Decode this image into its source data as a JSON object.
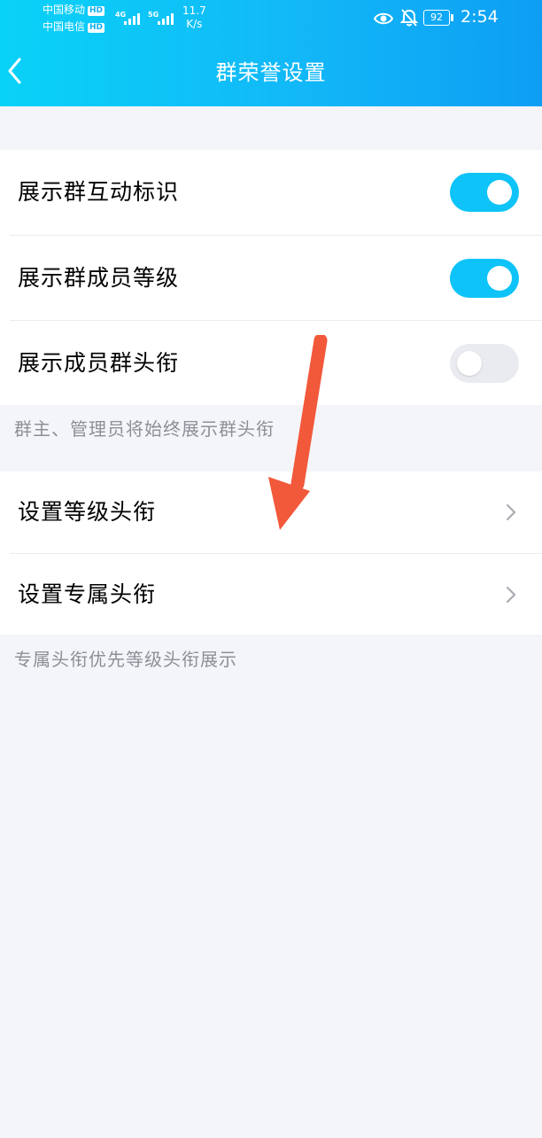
{
  "status_bar": {
    "carrier1": "中国移动",
    "carrier2": "中国电信",
    "hd_badge": "HD",
    "net1": "4G",
    "net2": "5G",
    "speed_value": "11.7",
    "speed_unit": "K/s",
    "battery": "92",
    "time": "2:54"
  },
  "header": {
    "title": "群荣誉设置"
  },
  "toggles": [
    {
      "label": "展示群互动标识",
      "on": true
    },
    {
      "label": "展示群成员等级",
      "on": true
    },
    {
      "label": "展示成员群头衔",
      "on": false
    }
  ],
  "toggles_note": "群主、管理员将始终展示群头衔",
  "links": [
    {
      "label": "设置等级头衔"
    },
    {
      "label": "设置专属头衔"
    }
  ],
  "links_note": "专属头衔优先等级头衔展示",
  "colors": {
    "header_start": "#09d2f7",
    "header_end": "#0d9ef4",
    "toggle_on": "#0ec3f7",
    "toggle_off": "#e9ebf0",
    "background": "#f4f5f9",
    "annotation_arrow": "#f2583a"
  },
  "icons": {
    "back": "chevron-left-icon",
    "eye": "eye-icon",
    "bell": "bell-off-icon",
    "battery": "battery-icon",
    "link": "chevron-right-icon"
  }
}
